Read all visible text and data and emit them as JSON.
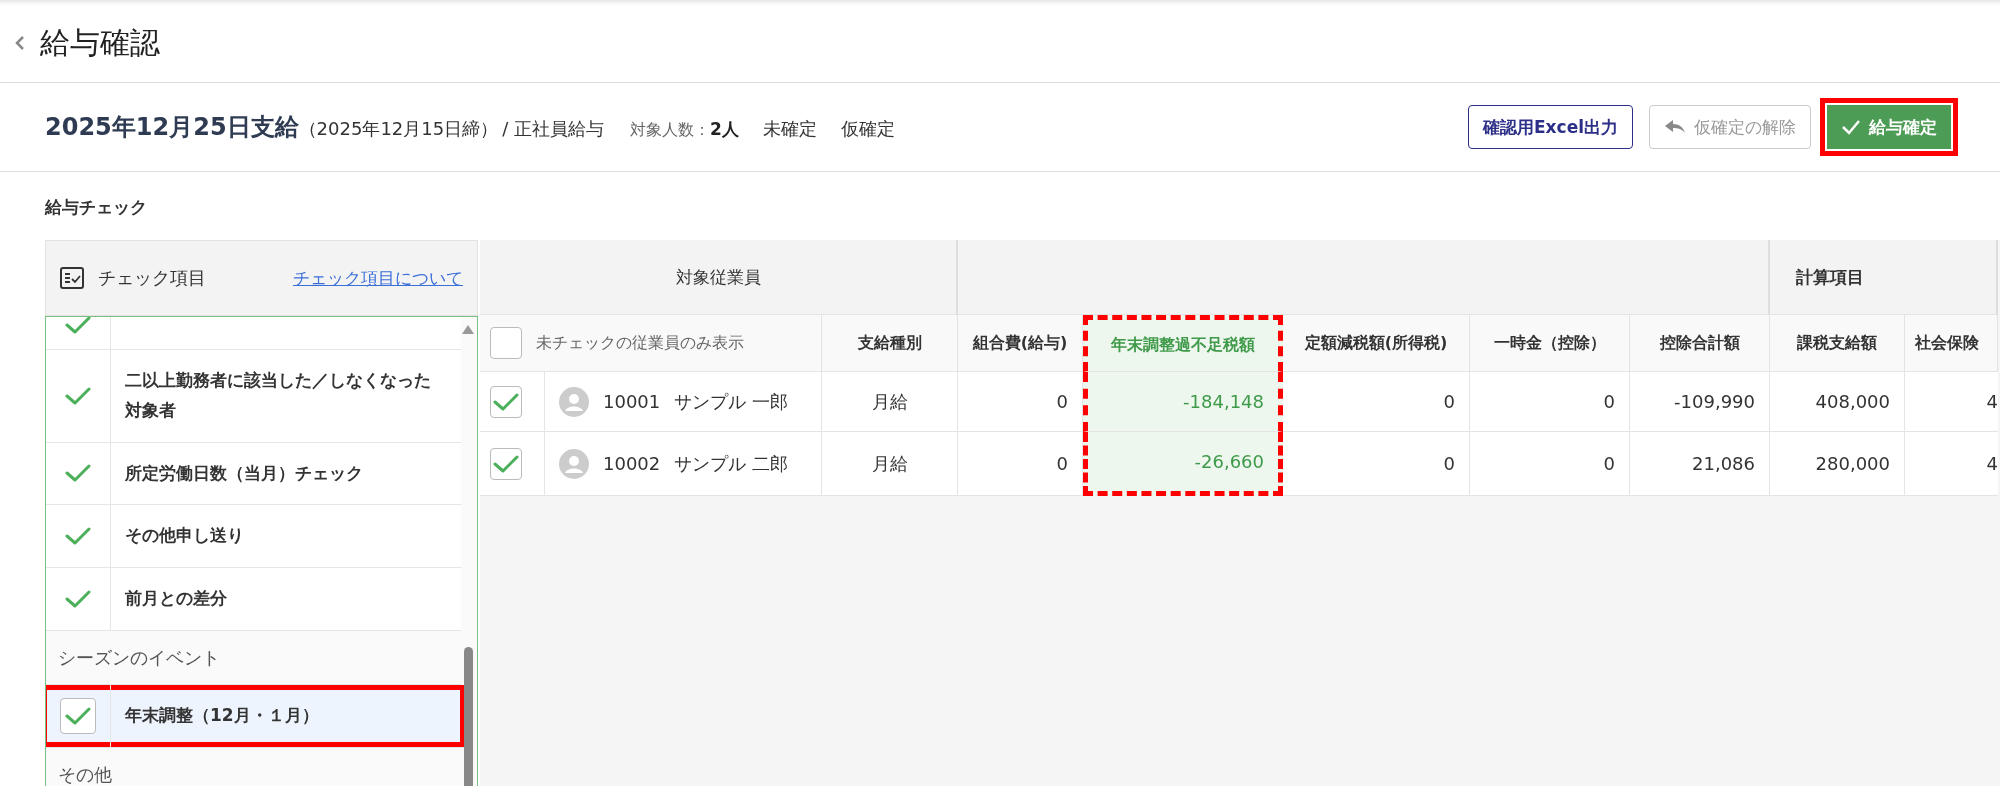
{
  "page": {
    "title": "給与確認"
  },
  "summary": {
    "pay_date": "2025年12月25日支給",
    "closing": "（2025年12月15日締）",
    "payroll": "/ 正社員給与",
    "headcount_label": "対象人数：",
    "headcount": "2人",
    "statuses": [
      "未確定",
      "仮確定"
    ]
  },
  "actions": [
    {
      "kind": "outline",
      "label": "確認用Excel出力",
      "disabled": false,
      "highlighted": false
    },
    {
      "kind": "undo",
      "label": "仮確定の解除",
      "disabled": true,
      "highlighted": false
    },
    {
      "kind": "primary",
      "label": "給与確定",
      "disabled": false,
      "highlighted": true
    }
  ],
  "checks": {
    "title": "給与チェック",
    "header": "チェック項目",
    "help_link": "チェック項目について",
    "items": [
      {
        "kind": "clipped",
        "checked": true,
        "selected": false,
        "highlighted": false
      },
      {
        "kind": "item",
        "label": "二以上勤務者に該当した／しなくなった対象者",
        "checked": true,
        "selected": false,
        "highlighted": false
      },
      {
        "kind": "item",
        "label": "所定労働日数（当月）チェック",
        "checked": true,
        "selected": false,
        "highlighted": false
      },
      {
        "kind": "item",
        "label": "その他申し送り",
        "checked": true,
        "selected": false,
        "highlighted": false
      },
      {
        "kind": "item",
        "label": "前月との差分",
        "checked": true,
        "selected": false,
        "highlighted": false
      },
      {
        "kind": "group",
        "label": "シーズンのイベント"
      },
      {
        "kind": "item",
        "label": "年末調整（12月・１月）",
        "checked": true,
        "selected": true,
        "highlighted": true
      },
      {
        "kind": "group",
        "label": "その他"
      }
    ]
  },
  "table": {
    "groups": [
      {
        "label": "対象従業員",
        "columns": [
          {
            "kind": "filter",
            "label": "未チェックの従業員のみ表示",
            "checked": false
          },
          {
            "kind": "text",
            "label": "支給種別"
          }
        ]
      },
      {
        "columns": [
          {
            "kind": "number",
            "label": "組合費(給与)",
            "highlighted": false
          },
          {
            "kind": "number",
            "label": "年末調整過不足税額",
            "highlighted": true
          },
          {
            "kind": "number",
            "label": "定額減税額(所得税)",
            "highlighted": false
          },
          {
            "kind": "number",
            "label": "一時金（控除）",
            "highlighted": false
          },
          {
            "kind": "number",
            "label": "控除合計額",
            "highlighted": false
          }
        ]
      },
      {
        "label": "計算項目",
        "columns": [
          {
            "kind": "number",
            "label": "課税支給額",
            "highlighted": false
          },
          {
            "kind": "number",
            "label": "社会保険",
            "highlighted": false
          }
        ]
      }
    ],
    "rows": [
      {
        "checked": true,
        "employee_id": "10001",
        "name": "サンプル 一郎",
        "pay_type": "月給",
        "values": [
          "0",
          "-184,148",
          "0",
          "0",
          "-109,990",
          "408,000",
          "4"
        ]
      },
      {
        "checked": true,
        "employee_id": "10002",
        "name": "サンプル 二郎",
        "pay_type": "月給",
        "values": [
          "0",
          "-26,660",
          "0",
          "0",
          "21,086",
          "280,000",
          "4"
        ]
      }
    ]
  }
}
